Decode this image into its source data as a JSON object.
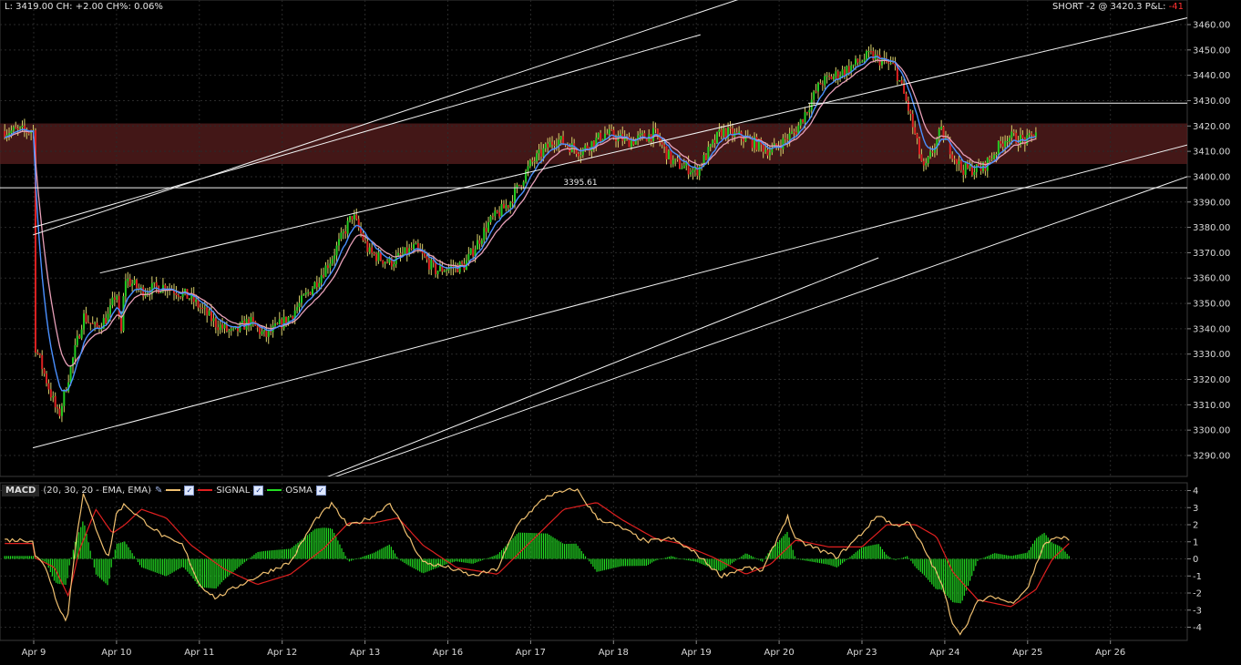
{
  "header": {
    "left_text": "L: 3419.00 CH: +2.00 CH%: 0.06%",
    "right_text": "SHORT -2 @ 3420.3 P&L:",
    "pnl": "-41"
  },
  "macd_legend": {
    "name": "MACD",
    "params": "(20, 30, 20 - EMA, EMA)",
    "signal_label": "SIGNAL",
    "osma_label": "OSMA"
  },
  "annotation_label": "3395.61",
  "colors": {
    "up_candle": "#22cc22",
    "down_candle": "#dd2222",
    "ma_fast": "#4a90ff",
    "ma_slow": "#e8a0b8",
    "macd_line": "#f0c070",
    "signal_line": "#e02020",
    "osma_bar": "#22dd22",
    "resistance_zone": "#5a1f1f",
    "grid": "#2a2a2a",
    "pnl": "#ff3030"
  },
  "chart_data": [
    {
      "type": "candlestick",
      "x_ticks": [
        "Apr 9",
        "Apr 10",
        "Apr 11",
        "Apr 12",
        "Apr 13",
        "Apr 16",
        "Apr 17",
        "Apr 18",
        "Apr 19",
        "Apr 20",
        "Apr 23",
        "Apr 24",
        "Apr 25",
        "Apr 26"
      ],
      "y_ticks": [
        3290,
        3300,
        3310,
        3320,
        3330,
        3340,
        3350,
        3360,
        3370,
        3380,
        3390,
        3400,
        3410,
        3420,
        3430,
        3440,
        3450,
        3460
      ],
      "ylim": [
        3281,
        3467
      ],
      "close_path": [
        [
          0,
          3335
        ],
        [
          0.05,
          3330
        ],
        [
          0.15,
          3320
        ],
        [
          0.3,
          3305
        ],
        [
          0.45,
          3325
        ],
        [
          0.6,
          3345
        ],
        [
          0.75,
          3340
        ],
        [
          0.9,
          3345
        ],
        [
          1.0,
          3355
        ],
        [
          1.05,
          3335
        ],
        [
          1.1,
          3360
        ],
        [
          1.3,
          3355
        ],
        [
          1.6,
          3357
        ],
        [
          1.9,
          3352
        ],
        [
          2.2,
          3342
        ],
        [
          2.4,
          3338
        ],
        [
          2.6,
          3343
        ],
        [
          2.8,
          3337
        ],
        [
          3.1,
          3345
        ],
        [
          3.4,
          3358
        ],
        [
          3.6,
          3368
        ],
        [
          3.85,
          3385
        ],
        [
          4.05,
          3370
        ],
        [
          4.3,
          3366
        ],
        [
          4.6,
          3372
        ],
        [
          4.85,
          3363
        ],
        [
          5.2,
          3365
        ],
        [
          5.5,
          3382
        ],
        [
          5.75,
          3390
        ],
        [
          6.0,
          3405
        ],
        [
          6.3,
          3415
        ],
        [
          6.6,
          3410
        ],
        [
          6.9,
          3417
        ],
        [
          7.2,
          3414
        ],
        [
          7.5,
          3417
        ],
        [
          7.7,
          3406
        ],
        [
          8.0,
          3402
        ],
        [
          8.3,
          3418
        ],
        [
          8.6,
          3415
        ],
        [
          8.9,
          3410
        ],
        [
          9.2,
          3418
        ],
        [
          9.5,
          3437
        ],
        [
          9.8,
          3442
        ],
        [
          10.1,
          3448
        ],
        [
          10.4,
          3443
        ],
        [
          10.55,
          3428
        ],
        [
          10.75,
          3402
        ],
        [
          10.95,
          3418
        ],
        [
          11.2,
          3403
        ],
        [
          11.45,
          3403
        ],
        [
          11.75,
          3416
        ],
        [
          12.0,
          3414
        ],
        [
          12.1,
          3418
        ]
      ],
      "horizontal_lines": [
        3429,
        3395.61
      ],
      "resistance_zone": [
        3405,
        3421
      ],
      "trendlines": [
        {
          "points": [
            [
              -0.01,
              3293
            ],
            [
              14.1,
              3414
            ]
          ]
        },
        {
          "points": [
            [
              0.8,
              3362
            ],
            [
              14.1,
              3464
            ]
          ]
        },
        {
          "points": [
            [
              -0.01,
              3377
            ],
            [
              8.7,
              3472
            ]
          ]
        },
        {
          "points": [
            [
              -0.01,
              3380
            ],
            [
              8.05,
              3456
            ]
          ]
        },
        {
          "points": [
            [
              3.5,
              3280
            ],
            [
              14.1,
              3402
            ]
          ]
        },
        {
          "points": [
            [
              3.5,
              3281
            ],
            [
              10.2,
              3368
            ]
          ]
        }
      ]
    },
    {
      "type": "line",
      "name": "MACD",
      "y_ticks": [
        -4,
        -3,
        -2,
        -1,
        0,
        1,
        2,
        3,
        4
      ],
      "ylim": [
        -4.8,
        4.3
      ],
      "macd_path": [
        [
          0,
          0.3
        ],
        [
          0.15,
          -0.5
        ],
        [
          0.28,
          -2.5
        ],
        [
          0.4,
          -3.8
        ],
        [
          0.52,
          1.5
        ],
        [
          0.6,
          3.8
        ],
        [
          0.72,
          2.2
        ],
        [
          0.9,
          0.0
        ],
        [
          1.0,
          2.7
        ],
        [
          1.1,
          3.2
        ],
        [
          1.28,
          2.4
        ],
        [
          1.6,
          1.2
        ],
        [
          1.8,
          0.8
        ],
        [
          2.0,
          -1.5
        ],
        [
          2.2,
          -2.3
        ],
        [
          2.5,
          -1.5
        ],
        [
          2.8,
          -0.8
        ],
        [
          3.1,
          -0.2
        ],
        [
          3.4,
          2.3
        ],
        [
          3.6,
          3.2
        ],
        [
          3.8,
          1.9
        ],
        [
          4.1,
          2.5
        ],
        [
          4.3,
          3.3
        ],
        [
          4.5,
          1.5
        ],
        [
          4.7,
          -0.2
        ],
        [
          5.0,
          -0.5
        ],
        [
          5.3,
          -1.0
        ],
        [
          5.6,
          -0.6
        ],
        [
          5.85,
          2.1
        ],
        [
          6.2,
          3.7
        ],
        [
          6.55,
          4.1
        ],
        [
          6.8,
          2.4
        ],
        [
          7.1,
          1.8
        ],
        [
          7.4,
          1.0
        ],
        [
          7.7,
          1.2
        ],
        [
          8.0,
          0.3
        ],
        [
          8.3,
          -1.0
        ],
        [
          8.6,
          -0.5
        ],
        [
          8.8,
          -0.7
        ],
        [
          9.1,
          2.5
        ],
        [
          9.2,
          1.1
        ],
        [
          9.5,
          0.5
        ],
        [
          9.7,
          0.1
        ],
        [
          10.0,
          1.5
        ],
        [
          10.2,
          2.6
        ],
        [
          10.4,
          1.9
        ],
        [
          10.55,
          2.2
        ],
        [
          10.75,
          0.6
        ],
        [
          10.95,
          -1.3
        ],
        [
          11.1,
          -3.8
        ],
        [
          11.2,
          -4.4
        ],
        [
          11.4,
          -2.5
        ],
        [
          11.6,
          -2.2
        ],
        [
          11.8,
          -2.6
        ],
        [
          12.0,
          -1.7
        ],
        [
          12.2,
          0.9
        ],
        [
          12.4,
          1.3
        ],
        [
          12.5,
          1.1
        ]
      ],
      "signal_path": [
        [
          0,
          0.1
        ],
        [
          0.25,
          -0.5
        ],
        [
          0.42,
          -2.2
        ],
        [
          0.55,
          0.5
        ],
        [
          0.75,
          2.9
        ],
        [
          0.95,
          1.5
        ],
        [
          1.1,
          2.0
        ],
        [
          1.3,
          2.9
        ],
        [
          1.6,
          2.4
        ],
        [
          1.9,
          0.8
        ],
        [
          2.3,
          -0.6
        ],
        [
          2.7,
          -1.5
        ],
        [
          3.1,
          -0.9
        ],
        [
          3.5,
          0.6
        ],
        [
          3.8,
          2.1
        ],
        [
          4.1,
          2.1
        ],
        [
          4.4,
          2.4
        ],
        [
          4.7,
          0.8
        ],
        [
          5.1,
          -0.5
        ],
        [
          5.6,
          -0.9
        ],
        [
          6.0,
          1.0
        ],
        [
          6.4,
          2.9
        ],
        [
          6.8,
          3.3
        ],
        [
          7.1,
          2.3
        ],
        [
          7.5,
          1.2
        ],
        [
          7.8,
          0.9
        ],
        [
          8.2,
          0.1
        ],
        [
          8.6,
          -0.9
        ],
        [
          8.9,
          -0.3
        ],
        [
          9.2,
          1.1
        ],
        [
          9.6,
          0.7
        ],
        [
          10.0,
          0.7
        ],
        [
          10.3,
          2.0
        ],
        [
          10.65,
          2.0
        ],
        [
          10.9,
          1.3
        ],
        [
          11.1,
          -0.8
        ],
        [
          11.4,
          -2.4
        ],
        [
          11.8,
          -2.8
        ],
        [
          12.1,
          -1.8
        ],
        [
          12.3,
          0.0
        ],
        [
          12.5,
          0.9
        ]
      ],
      "osma_bar_count": 560
    }
  ]
}
